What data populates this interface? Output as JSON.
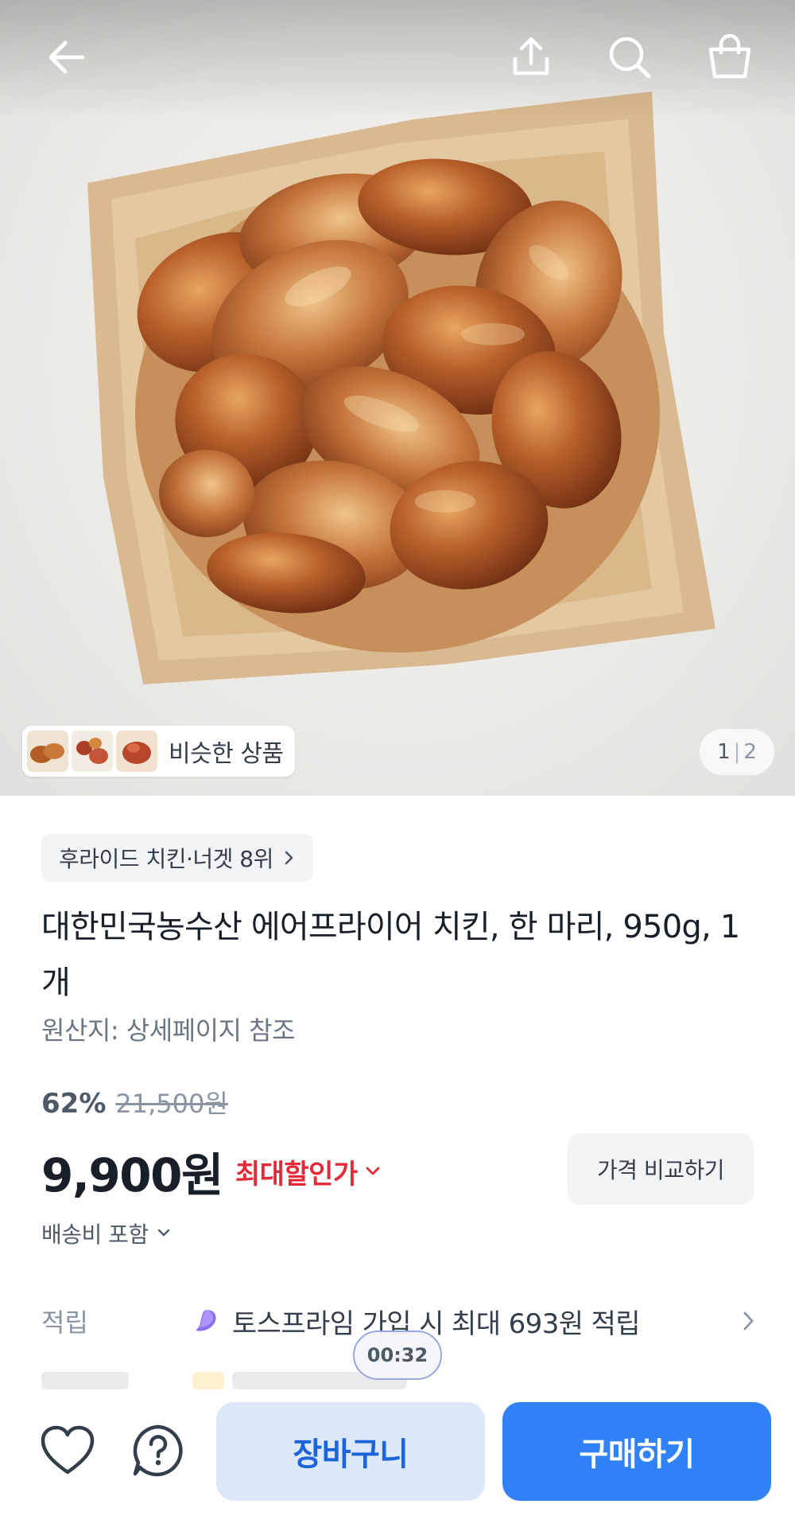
{
  "gallery": {
    "similar_label": "비슷한 상품",
    "page_current": "1",
    "page_total": "2"
  },
  "header": {
    "icons": [
      "back-arrow-icon",
      "share-icon",
      "search-icon",
      "shopping-bag-icon"
    ]
  },
  "product": {
    "category": "후라이드 치킨·너겟 8위",
    "title": "대한민국농수산 에어프라이어 치킨, 한 마리, 950g, 1개",
    "origin": "원산지: 상세페이지 참조",
    "discount_rate": "62%",
    "original_price": "21,500원",
    "price": "9,900원",
    "max_discount_label": "최대할인가",
    "compare_button": "가격 비교하기",
    "shipping": "배송비 포함"
  },
  "points": {
    "label": "적립",
    "text": "토스프라임 가입 시 최대 693원 적립"
  },
  "timer": "00:32",
  "actions": {
    "cart_button": "장바구니",
    "buy_button": "구매하기"
  },
  "colors": {
    "accent": "#3182f6",
    "discount_red": "#e42939",
    "cart_bg": "#dde8fb"
  }
}
